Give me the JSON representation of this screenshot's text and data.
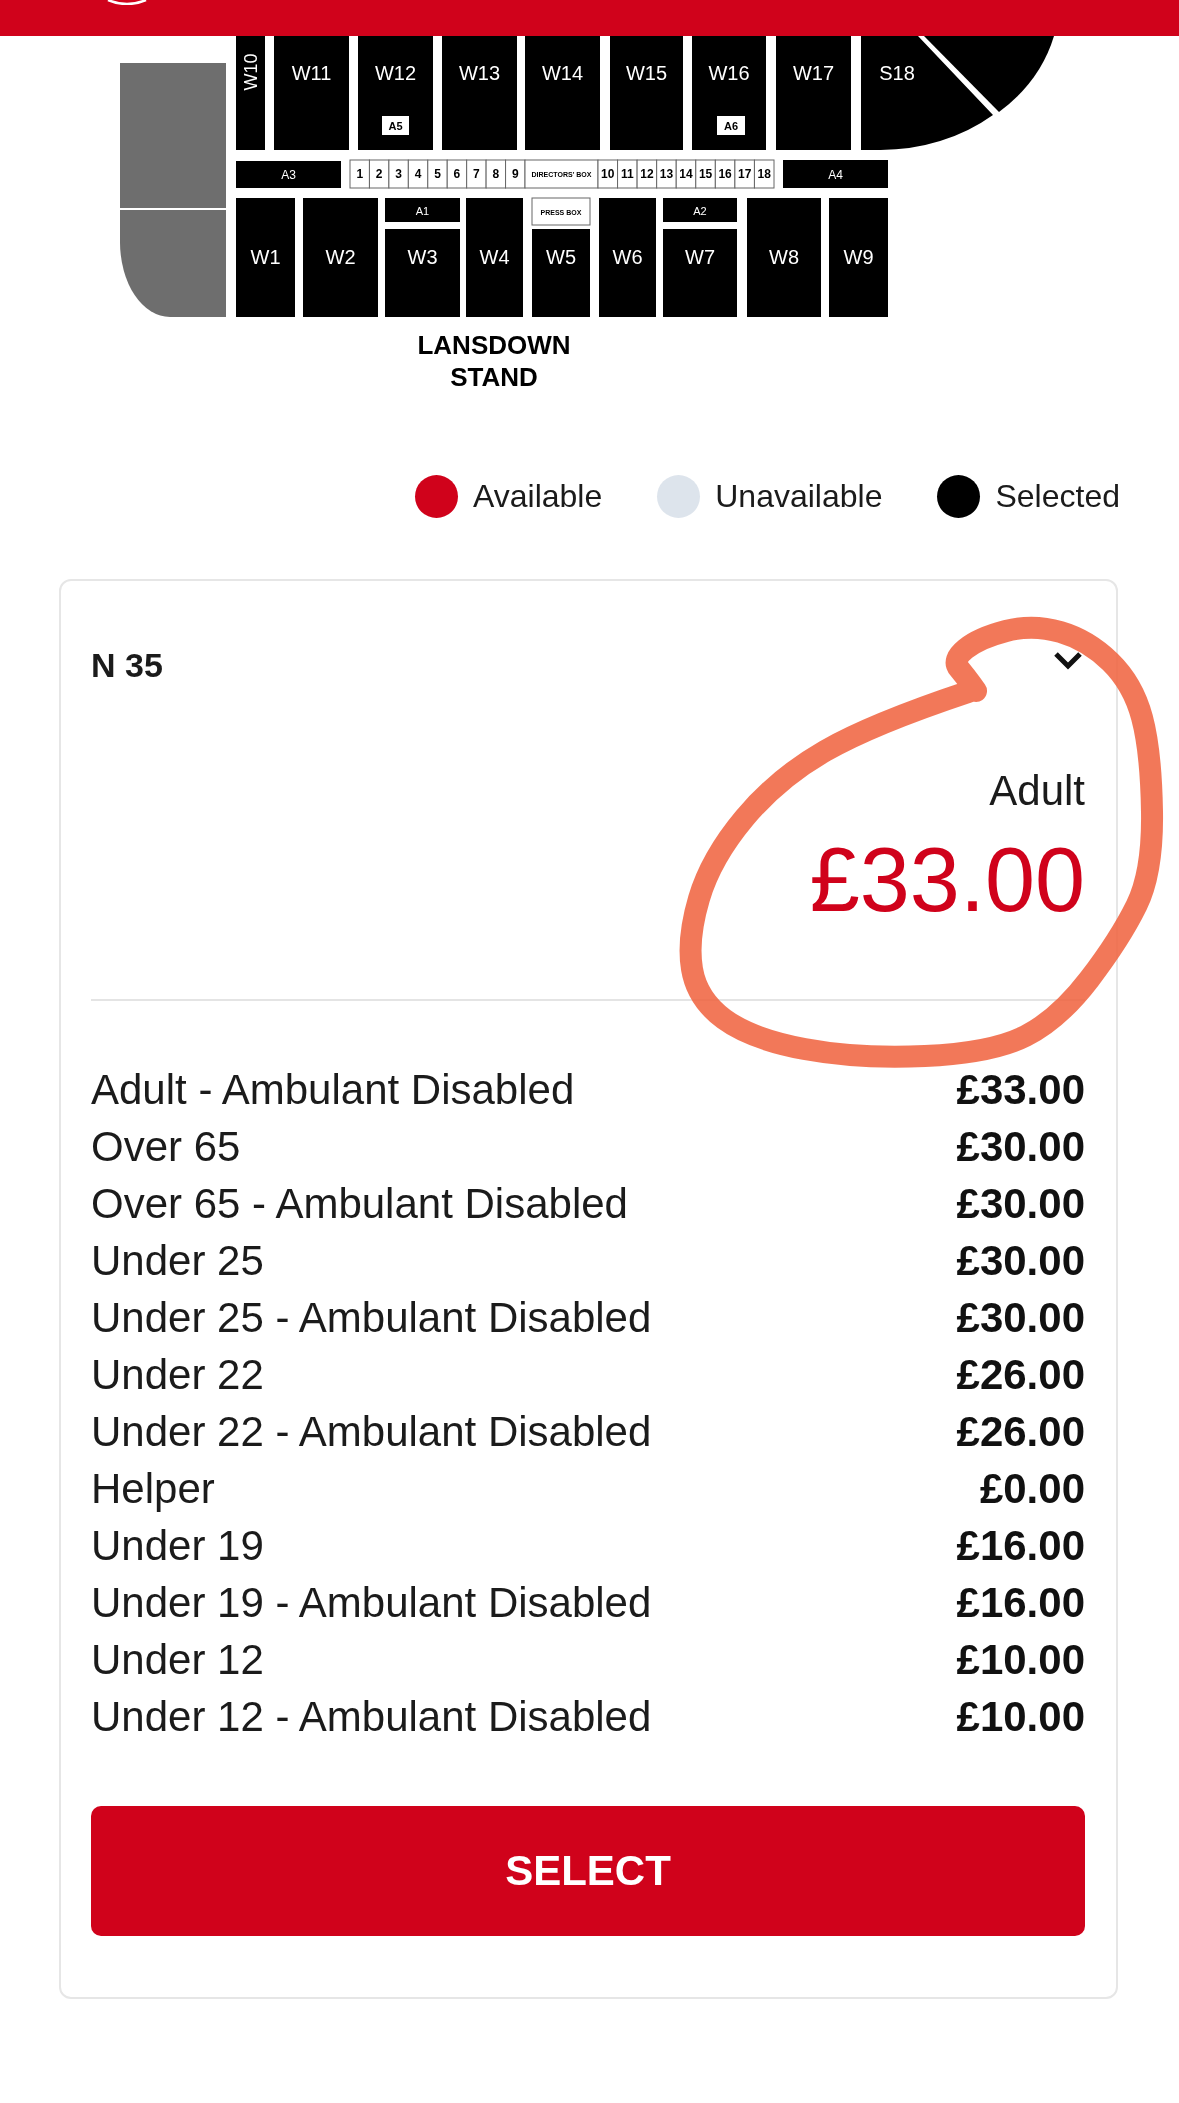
{
  "map": {
    "blocks": [
      {
        "label": "W10",
        "kind": "section"
      },
      {
        "label": "W11",
        "kind": "section"
      },
      {
        "label": "W12",
        "kind": "section"
      },
      {
        "label": "A5",
        "kind": "tag"
      },
      {
        "label": "W13",
        "kind": "section"
      },
      {
        "label": "W14",
        "kind": "section"
      },
      {
        "label": "W15",
        "kind": "section"
      },
      {
        "label": "W16",
        "kind": "section"
      },
      {
        "label": "A6",
        "kind": "tag"
      },
      {
        "label": "W17",
        "kind": "section"
      },
      {
        "label": "S18",
        "kind": "section"
      },
      {
        "label": "A3",
        "kind": "section"
      },
      {
        "label": "1",
        "kind": "box"
      },
      {
        "label": "2",
        "kind": "box"
      },
      {
        "label": "3",
        "kind": "box"
      },
      {
        "label": "4",
        "kind": "box"
      },
      {
        "label": "5",
        "kind": "box"
      },
      {
        "label": "6",
        "kind": "box"
      },
      {
        "label": "7",
        "kind": "box"
      },
      {
        "label": "8",
        "kind": "box"
      },
      {
        "label": "9",
        "kind": "box"
      },
      {
        "label": "DIRECTORS' BOX",
        "kind": "box"
      },
      {
        "label": "10",
        "kind": "box"
      },
      {
        "label": "11",
        "kind": "box"
      },
      {
        "label": "12",
        "kind": "box"
      },
      {
        "label": "13",
        "kind": "box"
      },
      {
        "label": "14",
        "kind": "box"
      },
      {
        "label": "15",
        "kind": "box"
      },
      {
        "label": "16",
        "kind": "box"
      },
      {
        "label": "17",
        "kind": "box"
      },
      {
        "label": "18",
        "kind": "box"
      },
      {
        "label": "A4",
        "kind": "section"
      },
      {
        "label": "W1",
        "kind": "section"
      },
      {
        "label": "W2",
        "kind": "section"
      },
      {
        "label": "A1",
        "kind": "section"
      },
      {
        "label": "W3",
        "kind": "section"
      },
      {
        "label": "W4",
        "kind": "section"
      },
      {
        "label": "PRESS BOX",
        "kind": "box"
      },
      {
        "label": "W5",
        "kind": "section"
      },
      {
        "label": "W6",
        "kind": "section"
      },
      {
        "label": "A2",
        "kind": "section"
      },
      {
        "label": "W7",
        "kind": "section"
      },
      {
        "label": "W8",
        "kind": "section"
      },
      {
        "label": "W9",
        "kind": "section"
      }
    ],
    "stand_label": "LANSDOWN STAND"
  },
  "legend": [
    {
      "label": "Available",
      "color": "#d0021b"
    },
    {
      "label": "Unavailable",
      "color": "#dde4ec"
    },
    {
      "label": "Selected",
      "color": "#000000"
    }
  ],
  "seat_card": {
    "seat": "N 35",
    "selected_type": "Adult",
    "selected_price": "£33.00",
    "prices": [
      {
        "label": "Adult - Ambulant Disabled",
        "price": "£33.00"
      },
      {
        "label": "Over 65",
        "price": "£30.00"
      },
      {
        "label": "Over 65 - Ambulant Disabled",
        "price": "£30.00"
      },
      {
        "label": "Under 25",
        "price": "£30.00"
      },
      {
        "label": "Under 25 - Ambulant Disabled",
        "price": "£30.00"
      },
      {
        "label": "Under 22",
        "price": "£26.00"
      },
      {
        "label": "Under 22 - Ambulant Disabled",
        "price": "£26.00"
      },
      {
        "label": "Helper",
        "price": "£0.00"
      },
      {
        "label": "Under 19",
        "price": "£16.00"
      },
      {
        "label": "Under 19 - Ambulant Disabled",
        "price": "£16.00"
      },
      {
        "label": "Under 12",
        "price": "£10.00"
      },
      {
        "label": "Under 12 - Ambulant Disabled",
        "price": "£10.00"
      }
    ],
    "button": "SELECT",
    "annotation": {
      "kind": "freehand-circle"
    }
  }
}
